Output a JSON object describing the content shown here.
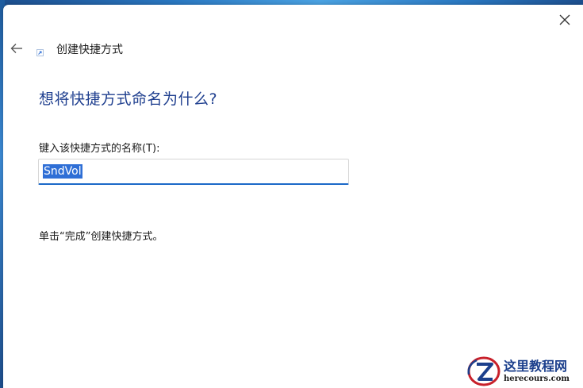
{
  "header": {
    "title": "创建快捷方式"
  },
  "main": {
    "heading": "想将快捷方式命名为什么?",
    "field_label": "键入该快捷方式的名称(T):",
    "input_value": "SndVol",
    "hint": "单击“完成”创建快捷方式。"
  },
  "watermark": {
    "name": "这里教程网",
    "domain": "herecours.com"
  },
  "icons": {
    "close": "close-icon",
    "back": "back-arrow-icon",
    "shortcut": "shortcut-icon"
  },
  "colors": {
    "heading": "#1f3f8f",
    "accent": "#1c69c8",
    "selection": "#2f6fd6"
  }
}
